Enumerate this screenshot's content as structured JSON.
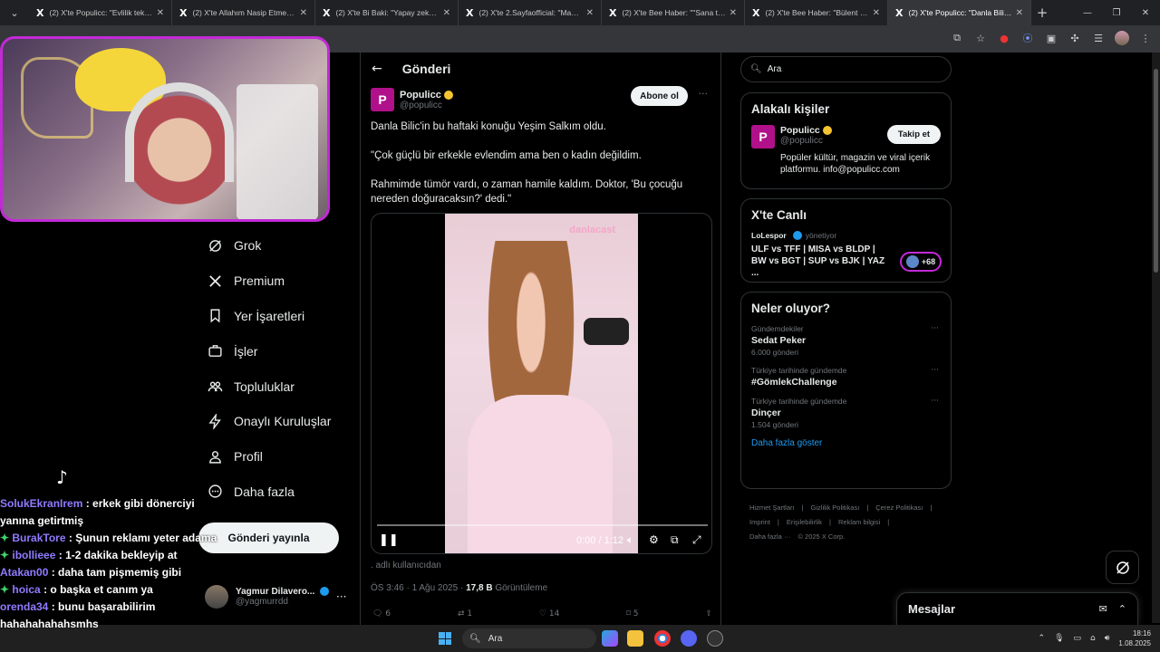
{
  "browser": {
    "tabs": [
      {
        "title": "(2) X'te Populicc: \"Evlilik teklifi a"
      },
      {
        "title": "(2) X'te Allahım Nasip Etme: \"Va"
      },
      {
        "title": "(2) X'te Bi Baki: \"Yapay zeka ile"
      },
      {
        "title": "(2) X'te 2.Sayfaofficial: \"Maskel"
      },
      {
        "title": "(2) X'te Bee Haber: \"\"Sana tatil"
      },
      {
        "title": "(2) X'te Bee Haber: \"Bülent Ers"
      },
      {
        "title": "(2) X'te Populicc: \"Danla Bilic'in"
      }
    ],
    "tab_logo": "X",
    "new_tab": "+",
    "win_controls": [
      "—",
      "❐",
      "✕"
    ]
  },
  "nav": {
    "items": [
      {
        "label": "Grok",
        "icon": "grok-icon"
      },
      {
        "label": "Premium",
        "icon": "x-logo-icon"
      },
      {
        "label": "Yer İşaretleri",
        "icon": "bookmark-icon"
      },
      {
        "label": "İşler",
        "icon": "briefcase-icon"
      },
      {
        "label": "Topluluklar",
        "icon": "communities-icon"
      },
      {
        "label": "Onaylı Kuruluşlar",
        "icon": "lightning-icon"
      },
      {
        "label": "Profil",
        "icon": "person-icon"
      },
      {
        "label": "Daha fazla",
        "icon": "more-circle-icon"
      }
    ],
    "post_button": "Gönderi yayınla",
    "profile": {
      "name": "Yagmur Dilavero...",
      "handle": "@yagmurrdd"
    }
  },
  "chat": {
    "lines": [
      {
        "user": "SolukEkranIrem",
        "text": ": erkek gibi dönerciyi",
        "badge": false
      },
      {
        "user": "",
        "text": "yanına getirtmiş",
        "badge": false
      },
      {
        "user": "BurakTore",
        "text": ": Şunun reklamı yeter adama",
        "badge": true
      },
      {
        "user": "ibollieee",
        "text": ": 1-2 dakika bekleyip at",
        "badge": true
      },
      {
        "user": "Atakan00",
        "text": ": daha tam pişmemiş gibi",
        "badge": false
      },
      {
        "user": "hoica",
        "text": ": o başka et canım ya",
        "badge": true
      },
      {
        "user": "orenda34",
        "text": ": bunu başarabilirim",
        "badge": false
      },
      {
        "user": "",
        "text": "hahahahahahsmhs",
        "badge": false
      }
    ]
  },
  "post": {
    "header": "Gönderi",
    "author_name": "Populicc",
    "author_handle": "@populicc",
    "logo_letter": "P",
    "subscribe": "Abone ol",
    "paragraphs": [
      "Danla Bilic'in bu haftaki konuğu Yeşim Salkım oldu.",
      "\"Çok güçlü bir erkekle evlendim ama ben o kadın değildim.",
      "Rahmimde tümör vardı, o zaman hamile kaldım. Doktor, 'Bu çocuğu nereden doğuracaksın?' dedi.\""
    ],
    "video": {
      "watermark": "danlacast",
      "time": "0:00 / 1:12"
    },
    "alt_user": ". adlı kullanıcıdan",
    "time": "ÖS 3:46 · 1 Ağu 2025 · ",
    "views_count": "17,8 B",
    "views_label": " Görüntüleme",
    "stats": {
      "replies": "6",
      "reposts": "1",
      "likes": "14",
      "bookmarks": "5"
    }
  },
  "right": {
    "search_placeholder": "Ara",
    "related": {
      "title": "Alakalı kişiler",
      "name": "Populicc",
      "handle": "@populicc",
      "follow": "Takip et",
      "bio": "Popüler kültür, magazin ve viral içerik platformu. info@populicc.com"
    },
    "live": {
      "title": "X'te Canlı",
      "host": "LoLespor",
      "role": "yönetiyor",
      "stream_title": "ULF vs TFF | MISA vs BLDP | BW vs BGT | SUP vs BJK | YAZ ...",
      "count": "+68"
    },
    "trends": {
      "title": "Neler oluyor?",
      "items": [
        {
          "cat": "Gündemdekiler",
          "name": "Sedat Peker",
          "count": "6.000 gönderi"
        },
        {
          "cat": "Türkiye tarihinde gündemde",
          "name": "#GömlekChallenge",
          "count": ""
        },
        {
          "cat": "Türkiye tarihinde gündemde",
          "name": "Dinçer",
          "count": "1.504 gönderi"
        }
      ],
      "show_more": "Daha fazla göster"
    },
    "footer": {
      "line1": [
        "Hizmet Şartları",
        "Gizlilik Politikası",
        "Çerez Politikası"
      ],
      "line2": [
        "Imprint",
        "Erişilebilirlik",
        "Reklam bilgisi"
      ],
      "line3": [
        "Daha fazla ···",
        "© 2025 X Corp."
      ]
    },
    "messages": "Mesajlar"
  },
  "taskbar": {
    "search": "Ara",
    "time": "18:16",
    "date": "1.08.2025"
  }
}
